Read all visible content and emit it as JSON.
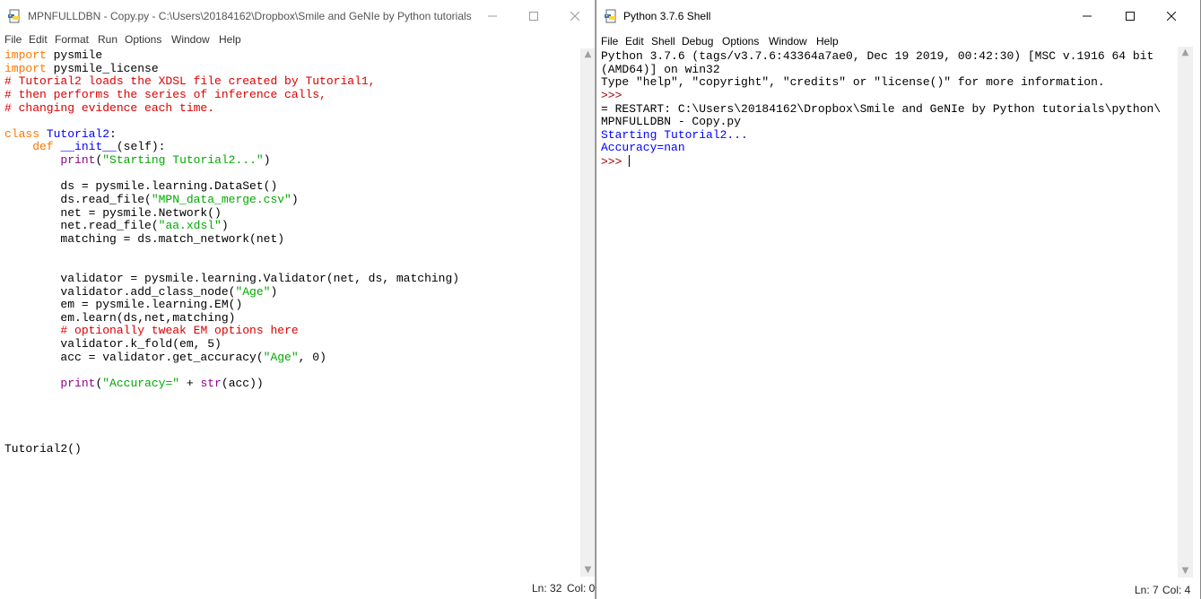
{
  "editor": {
    "title": "MPNFULLDBN - Copy.py - C:\\Users\\20184162\\Dropbox\\Smile and GeNIe by Python tutorials...",
    "menu": [
      "File",
      "Edit",
      "Format",
      "Run",
      "Options",
      "Window",
      "Help"
    ],
    "code_lines": [
      [
        {
          "t": "import",
          "c": "kw"
        },
        {
          "t": " pysmile"
        }
      ],
      [
        {
          "t": "import",
          "c": "kw"
        },
        {
          "t": " pysmile_license"
        }
      ],
      [
        {
          "t": "# Tutorial2 loads the XDSL file created by Tutorial1,",
          "c": "cm"
        }
      ],
      [
        {
          "t": "# then performs the series of inference calls,",
          "c": "cm"
        }
      ],
      [
        {
          "t": "# changing evidence each time.",
          "c": "cm"
        }
      ],
      [],
      [
        {
          "t": "class",
          "c": "kw"
        },
        {
          "t": " "
        },
        {
          "t": "Tutorial2",
          "c": "df"
        },
        {
          "t": ":"
        }
      ],
      [
        {
          "t": "    "
        },
        {
          "t": "def",
          "c": "kw"
        },
        {
          "t": " "
        },
        {
          "t": "__init__",
          "c": "df"
        },
        {
          "t": "(self):"
        }
      ],
      [
        {
          "t": "        "
        },
        {
          "t": "print",
          "c": "bi"
        },
        {
          "t": "("
        },
        {
          "t": "\"Starting Tutorial2...\"",
          "c": "str"
        },
        {
          "t": ")"
        }
      ],
      [],
      [
        {
          "t": "        ds = pysmile.learning.DataSet()"
        }
      ],
      [
        {
          "t": "        ds.read_file("
        },
        {
          "t": "\"MPN_data_merge.csv\"",
          "c": "str"
        },
        {
          "t": ")"
        }
      ],
      [
        {
          "t": "        net = pysmile.Network()"
        }
      ],
      [
        {
          "t": "        net.read_file("
        },
        {
          "t": "\"aa.xdsl\"",
          "c": "str"
        },
        {
          "t": ")"
        }
      ],
      [
        {
          "t": "        matching = ds.match_network(net)"
        }
      ],
      [],
      [],
      [
        {
          "t": "        validator = pysmile.learning.Validator(net, ds, matching)"
        }
      ],
      [
        {
          "t": "        validator.add_class_node("
        },
        {
          "t": "\"Age\"",
          "c": "str"
        },
        {
          "t": ")"
        }
      ],
      [
        {
          "t": "        em = pysmile.learning.EM()"
        }
      ],
      [
        {
          "t": "        em.learn(ds,net,matching)"
        }
      ],
      [
        {
          "t": "        "
        },
        {
          "t": "# optionally tweak EM options here",
          "c": "cm"
        }
      ],
      [
        {
          "t": "        validator.k_fold(em, 5)"
        }
      ],
      [
        {
          "t": "        acc = validator.get_accuracy("
        },
        {
          "t": "\"Age\"",
          "c": "str"
        },
        {
          "t": ", 0)"
        }
      ],
      [],
      [
        {
          "t": "        "
        },
        {
          "t": "print",
          "c": "bi"
        },
        {
          "t": "("
        },
        {
          "t": "\"Accuracy=\"",
          "c": "str"
        },
        {
          "t": " + "
        },
        {
          "t": "str",
          "c": "bi"
        },
        {
          "t": "(acc))"
        }
      ],
      [],
      [],
      [],
      [],
      [
        {
          "t": "Tutorial2()"
        }
      ]
    ],
    "status": {
      "ln": "Ln: 32",
      "col": "Col: 0"
    }
  },
  "shell": {
    "title": "Python 3.7.6 Shell",
    "menu": [
      "File",
      "Edit",
      "Shell",
      "Debug",
      "Options",
      "Window",
      "Help"
    ],
    "lines": [
      [
        {
          "t": "Python 3.7.6 (tags/v3.7.6:43364a7ae0, Dec 19 2019, 00:42:30) [MSC v.1916 64 bit"
        }
      ],
      [
        {
          "t": "(AMD64)] on win32"
        }
      ],
      [
        {
          "t": "Type \"help\", \"copyright\", \"credits\" or \"license()\" for more information."
        }
      ],
      [
        {
          "t": ">>> ",
          "c": "prompt"
        }
      ],
      [
        {
          "t": "= RESTART: C:\\Users\\20184162\\Dropbox\\Smile and GeNIe by Python tutorials\\python\\"
        }
      ],
      [
        {
          "t": "MPNFULLDBN - Copy.py"
        }
      ],
      [
        {
          "t": "Starting Tutorial2...",
          "c": "out"
        }
      ],
      [
        {
          "t": "Accuracy=nan",
          "c": "out"
        }
      ],
      [
        {
          "t": ">>> ",
          "c": "prompt"
        },
        {
          "cursor": true
        }
      ]
    ],
    "status": {
      "ln": "Ln: 7",
      "col": "Col: 4"
    }
  }
}
